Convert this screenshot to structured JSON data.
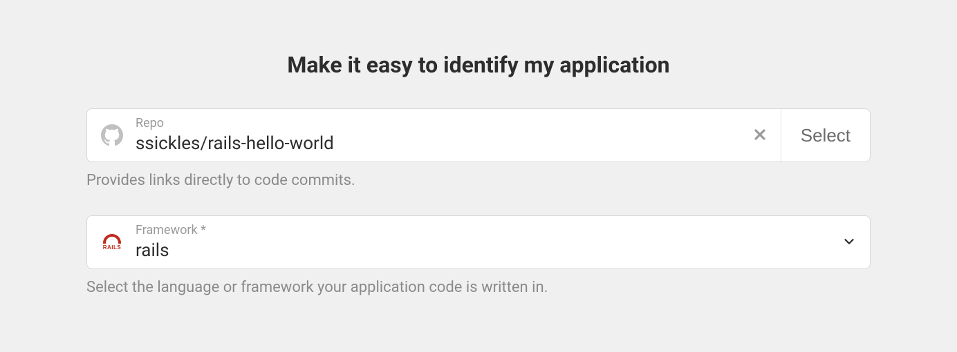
{
  "title": "Make it easy to identify my application",
  "repo": {
    "label": "Repo",
    "value": "ssickles/rails-hello-world",
    "select_label": "Select",
    "helper": "Provides links directly to code commits."
  },
  "framework": {
    "label": "Framework *",
    "value": "rails",
    "helper": "Select the language or framework your application code is written in.",
    "icon_text": "RAILS"
  }
}
